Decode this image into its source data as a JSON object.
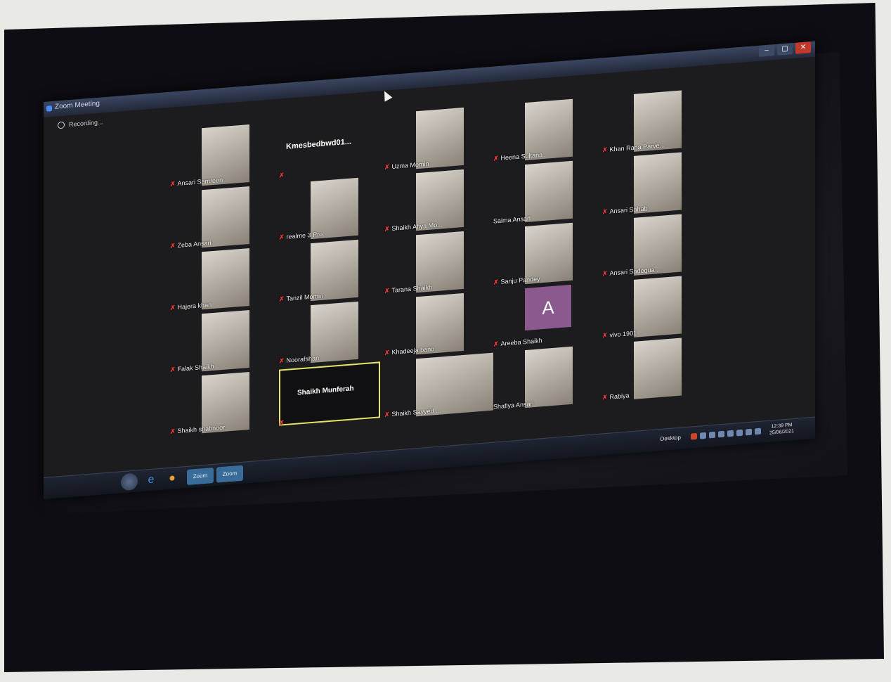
{
  "window": {
    "title": "Zoom Meeting",
    "controls": [
      "–",
      "▢",
      "✕"
    ]
  },
  "recording": {
    "label": "Recording..."
  },
  "colors": {
    "mic_muted": "#ff3b3b",
    "active_border": "#e7e36a",
    "avatar_bg": "#8a5a8f"
  },
  "participants": [
    {
      "name": "Ansari Samreen",
      "kind": "video"
    },
    {
      "name": "Kmesbedbwd01...",
      "kind": "text"
    },
    {
      "name": "Uzma Momin",
      "kind": "video"
    },
    {
      "name": "Heena Sultana",
      "kind": "video"
    },
    {
      "name": "Khan Rana Parve...",
      "kind": "video"
    },
    {
      "name": "Zeba Ansari",
      "kind": "video"
    },
    {
      "name": "realme 3 Pro",
      "kind": "video"
    },
    {
      "name": "Shaikh Afiya Mo...",
      "kind": "video"
    },
    {
      "name": "Saima Ansari",
      "kind": "video"
    },
    {
      "name": "Ansari Sahab",
      "kind": "video"
    },
    {
      "name": "Hajera khan",
      "kind": "video"
    },
    {
      "name": "Tanzil Momin",
      "kind": "video"
    },
    {
      "name": "Tarana Shaikh",
      "kind": "video"
    },
    {
      "name": "Sanju Pandey",
      "kind": "video"
    },
    {
      "name": "Ansari Sadequa ...",
      "kind": "video"
    },
    {
      "name": "Falak Shaikh",
      "kind": "video"
    },
    {
      "name": "Noorafshan",
      "kind": "video"
    },
    {
      "name": "Khadeeja bano",
      "kind": "video"
    },
    {
      "name": "Areeba Shaikh",
      "kind": "avatar",
      "initial": "A"
    },
    {
      "name": "vivo 1901",
      "kind": "video"
    },
    {
      "name": "Shaikh shabnoor",
      "kind": "video"
    },
    {
      "name": "Shaikh Munferah",
      "kind": "active"
    },
    {
      "name": "Shaikh Sayyed ...",
      "kind": "video"
    },
    {
      "name": "Shafiya Ansari",
      "kind": "video"
    },
    {
      "name": "Rabiya",
      "kind": "video"
    }
  ],
  "taskbar": {
    "tasks": [
      "Zoom",
      "Zoom"
    ],
    "desktop_label": "Desktop",
    "time": "12:39 PM",
    "date": "25/06/2021"
  }
}
